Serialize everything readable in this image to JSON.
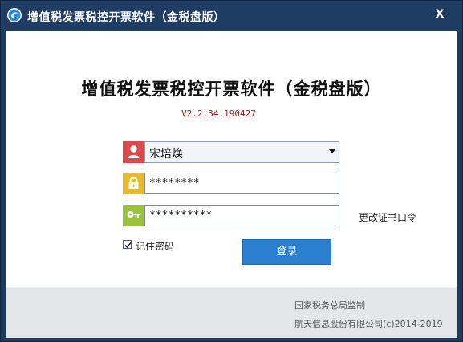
{
  "window": {
    "title": "增值税发票税控开票软件（金税盘版）",
    "close_label": "X"
  },
  "main": {
    "title": "增值税发票税控开票软件（金税盘版）",
    "version": "V2.2.34.190427"
  },
  "form": {
    "user": {
      "selected": "宋培焕",
      "icon": "user-icon"
    },
    "password": {
      "value": "********",
      "icon": "lock-icon"
    },
    "cert_password": {
      "value": "**********",
      "icon": "key-icon"
    },
    "change_cert_label": "更改证书口令",
    "remember_label": "记住密码",
    "remember_checked": true,
    "login_label": "登录"
  },
  "footer": {
    "supervisor": "国家税务总局监制",
    "copyright": "航天信息股份有限公司(c)2014-2019"
  },
  "colors": {
    "titlebar": "#1f3d62",
    "user_icon_bg": "#d94a4a",
    "lock_icon_bg": "#e8bb2f",
    "key_icon_bg": "#9ac23c",
    "login_button": "#2b7fd0",
    "version_text": "#a01818"
  }
}
